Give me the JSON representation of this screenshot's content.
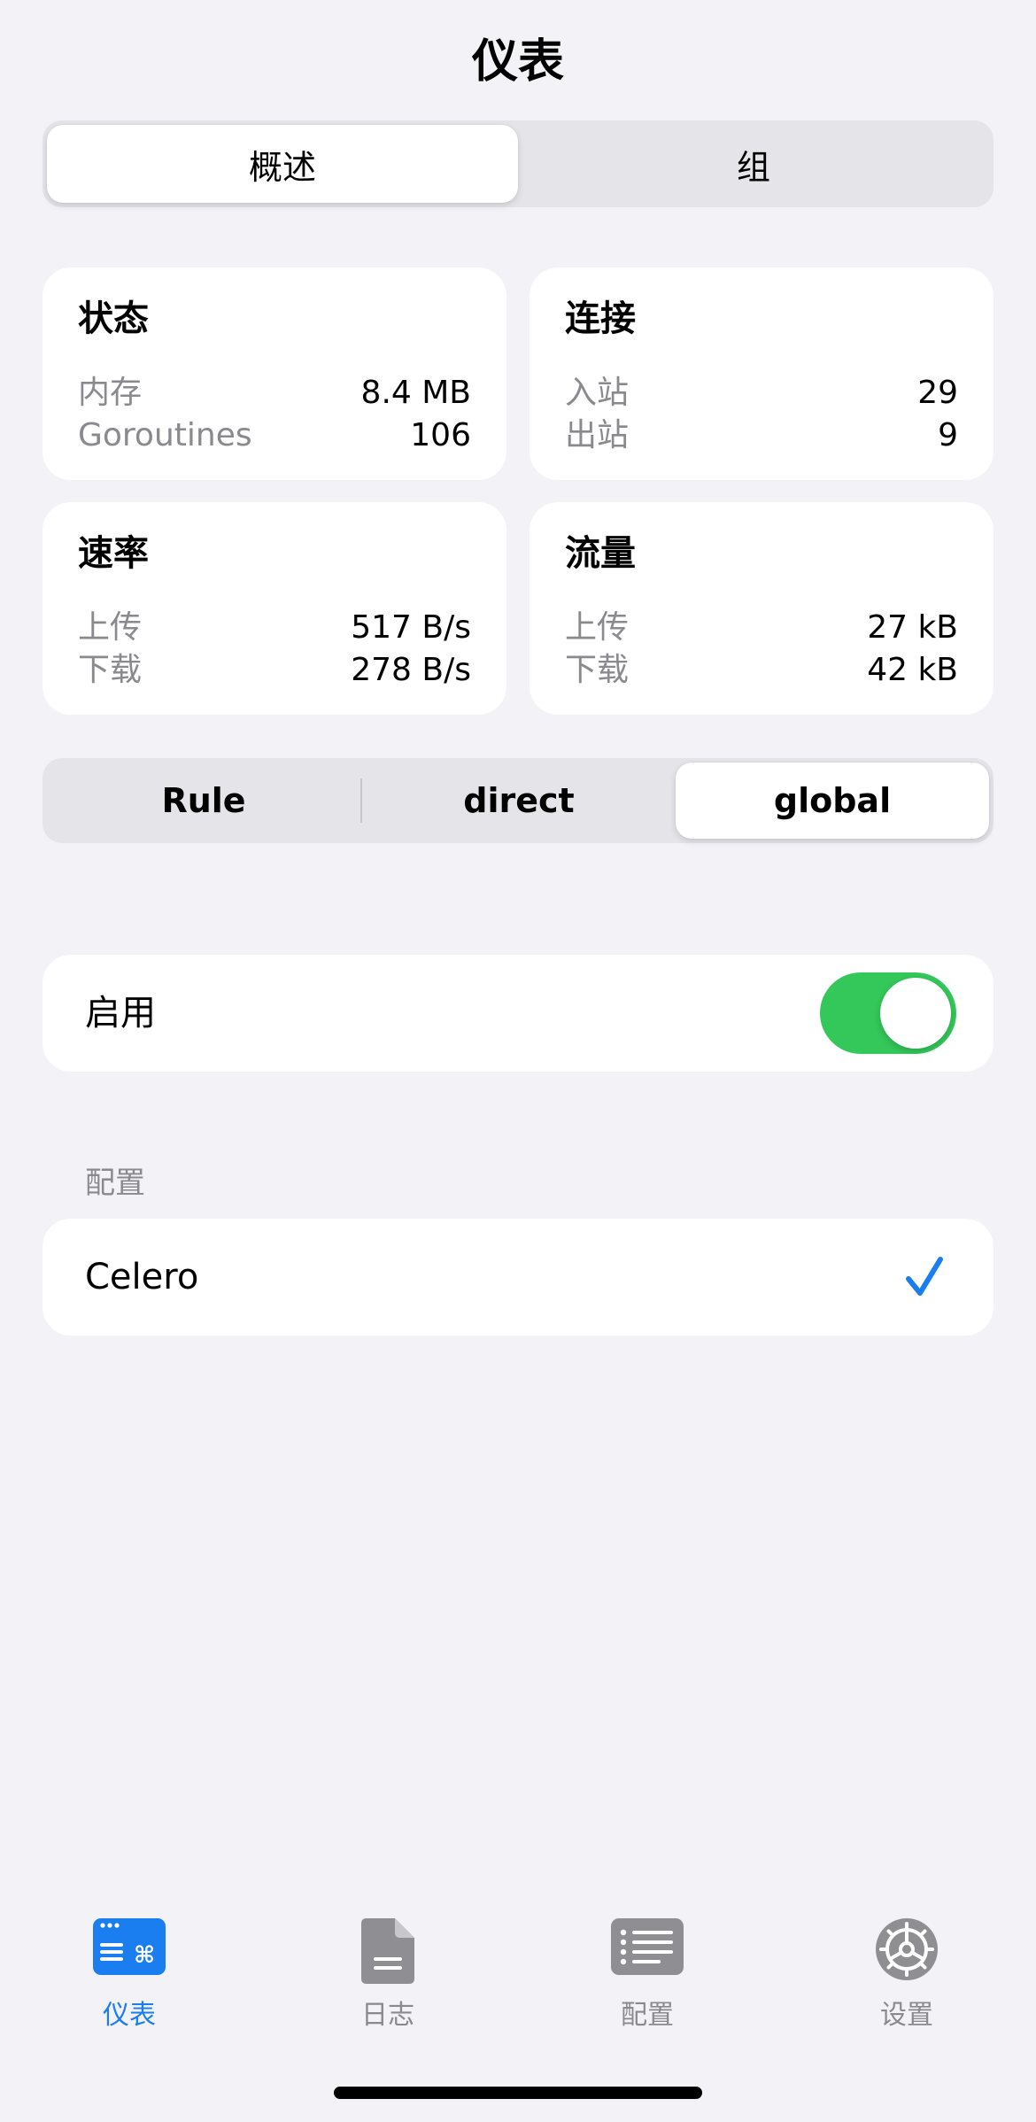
{
  "nav": {
    "title": "仪表"
  },
  "top_tabs": [
    {
      "label": "概述",
      "selected": true
    },
    {
      "label": "组",
      "selected": false
    }
  ],
  "cards": {
    "status": {
      "title": "状态",
      "rows": [
        {
          "label": "内存",
          "value": "8.4 MB"
        },
        {
          "label": "Goroutines",
          "value": "106"
        }
      ]
    },
    "connections": {
      "title": "连接",
      "rows": [
        {
          "label": "入站",
          "value": "29"
        },
        {
          "label": "出站",
          "value": "9"
        }
      ]
    },
    "speed": {
      "title": "速率",
      "rows": [
        {
          "label": "上传",
          "value": "517 B/s"
        },
        {
          "label": "下载",
          "value": "278 B/s"
        }
      ]
    },
    "traffic": {
      "title": "流量",
      "rows": [
        {
          "label": "上传",
          "value": "27 kB"
        },
        {
          "label": "下载",
          "value": "42 kB"
        }
      ]
    }
  },
  "mode_tabs": [
    {
      "label": "Rule",
      "selected": false
    },
    {
      "label": "direct",
      "selected": false
    },
    {
      "label": "global",
      "selected": true
    }
  ],
  "enable": {
    "label": "启用",
    "on": true
  },
  "profiles": {
    "header": "配置",
    "items": [
      {
        "name": "Celero",
        "checked": true
      }
    ]
  },
  "tabbar": {
    "items": [
      {
        "label": "仪表",
        "icon": "dashboard-icon",
        "active": true
      },
      {
        "label": "日志",
        "icon": "document-icon",
        "active": false
      },
      {
        "label": "配置",
        "icon": "list-icon",
        "active": false
      },
      {
        "label": "设置",
        "icon": "gear-icon",
        "active": false
      }
    ]
  },
  "colors": {
    "accent": "#1a7df0",
    "toggle_on": "#34c759",
    "background": "#f2f2f7",
    "secondary_text": "#8a8a8e"
  }
}
